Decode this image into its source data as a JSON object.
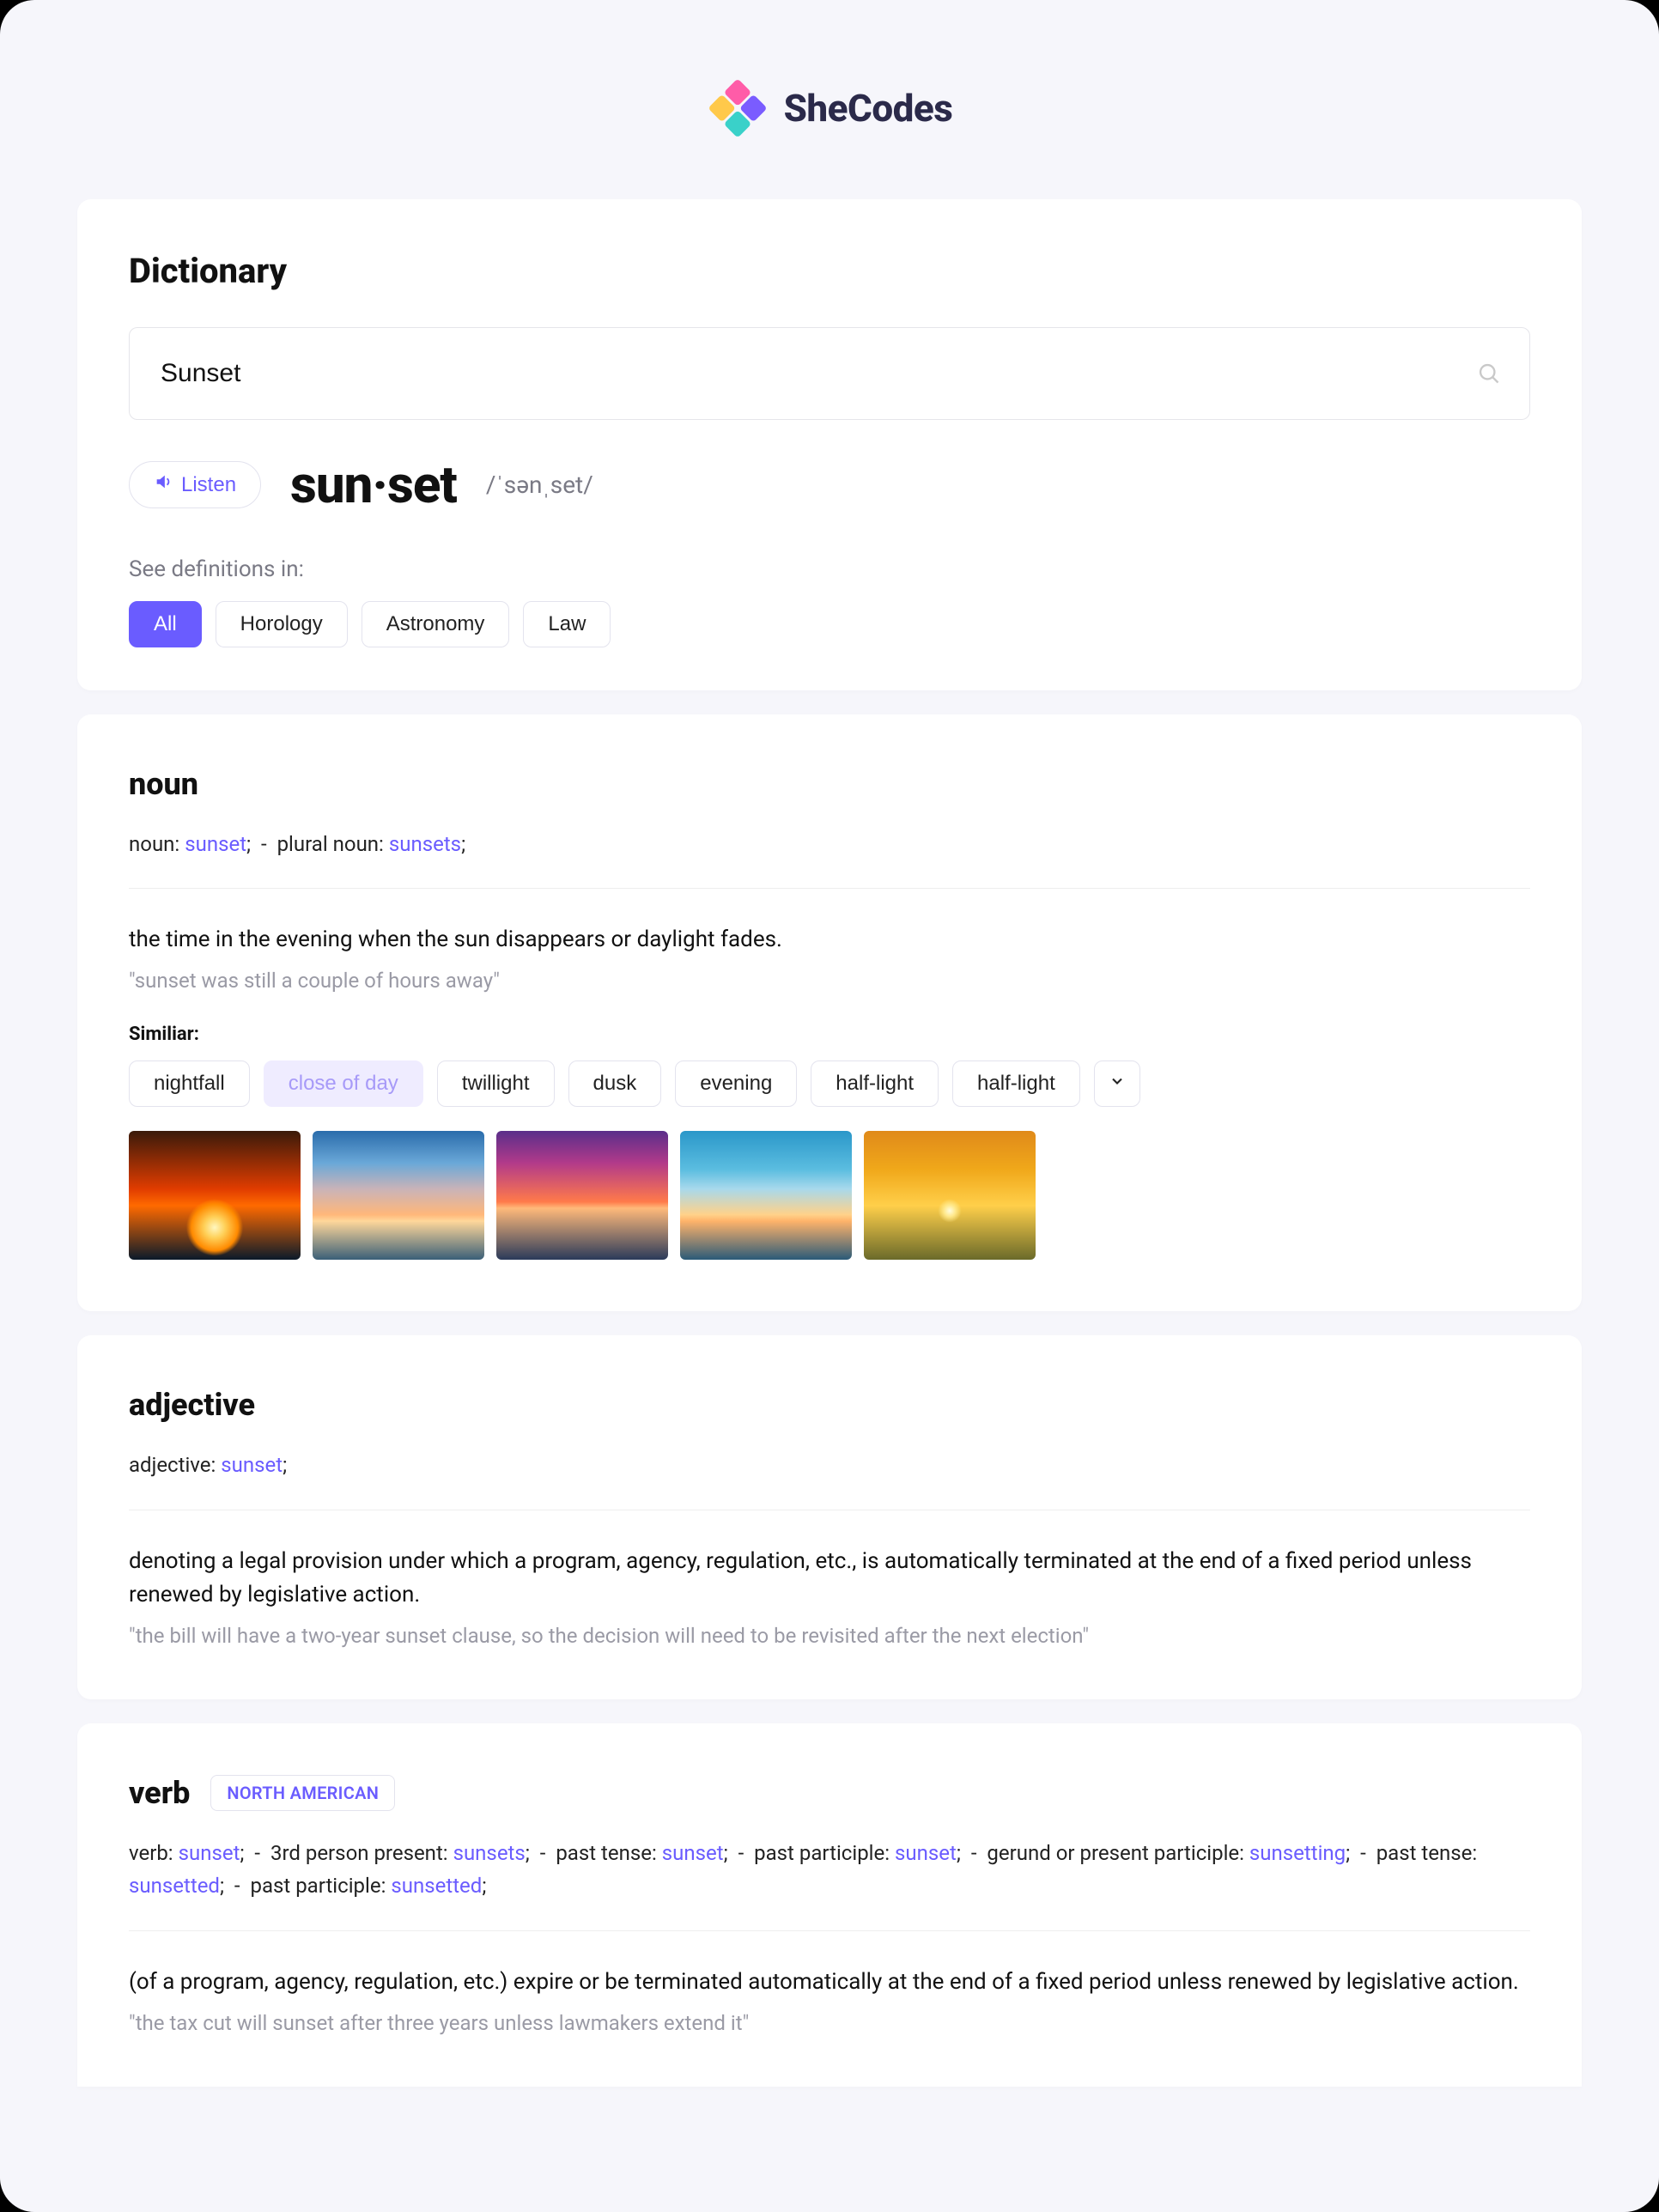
{
  "brand": {
    "name": "SheCodes"
  },
  "header": {
    "title": "Dictionary",
    "search_value": "Sunset"
  },
  "entry": {
    "listen_label": "Listen",
    "word": "sun·set",
    "phonetic": "/ˈsənˌset/",
    "see_in_label": "See definitions in:",
    "categories": [
      "All",
      "Horology",
      "Astronomy",
      "Law"
    ],
    "active_category_index": 0
  },
  "noun": {
    "title": "noun",
    "forms": [
      {
        "label": "noun",
        "value": "sunset"
      },
      {
        "label": "plural noun",
        "value": "sunsets"
      }
    ],
    "definition": "the time in the evening when the sun disappears or daylight fades.",
    "example": "\"sunset was still a couple of hours away\"",
    "similar_label": "Similiar:",
    "similar": [
      "nightfall",
      "close of day",
      "twillight",
      "dusk",
      "evening",
      "half-light",
      "half-light"
    ],
    "similar_highlight_index": 1
  },
  "adjective": {
    "title": "adjective",
    "forms": [
      {
        "label": "adjective",
        "value": "sunset"
      }
    ],
    "definition": "denoting a legal provision under which a program, agency, regulation, etc., is automatically terminated at the end of a fixed period unless renewed by legislative action.",
    "example": "\"the bill will have a two-year sunset clause, so the decision will need to be revisited after the next election\""
  },
  "verb": {
    "title": "verb",
    "badge": "NORTH AMERICAN",
    "forms": [
      {
        "label": "verb",
        "value": "sunset"
      },
      {
        "label": "3rd person present",
        "value": "sunsets"
      },
      {
        "label": "past tense",
        "value": "sunset"
      },
      {
        "label": "past participle",
        "value": "sunset"
      },
      {
        "label": "gerund or present participle",
        "value": "sunsetting"
      },
      {
        "label": "past tense",
        "value": "sunsetted"
      },
      {
        "label": "past participle",
        "value": "sunsetted"
      }
    ],
    "definition": "(of a program, agency, regulation, etc.) expire or be terminated automatically at the end of a fixed period unless renewed by legislative action.",
    "example": "\"the tax cut will sunset after three years unless lawmakers extend it\""
  }
}
